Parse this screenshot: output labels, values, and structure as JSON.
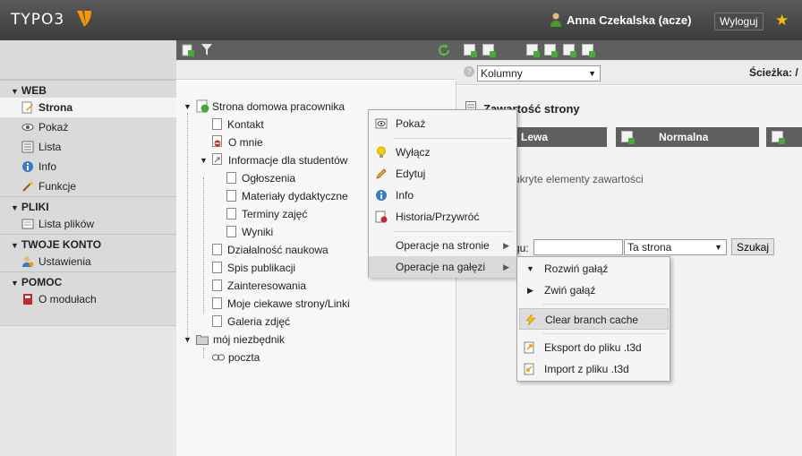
{
  "header": {
    "logo_text": "TYPO3",
    "user_name": "Anna Czekalska (acze)",
    "logout_label": "Wyloguj"
  },
  "module_menu": {
    "groups": [
      {
        "title": "WEB",
        "items": [
          {
            "label": "Strona",
            "icon": "page-edit-icon",
            "active": true
          },
          {
            "label": "Pokaż",
            "icon": "eye-icon"
          },
          {
            "label": "Lista",
            "icon": "list-icon"
          },
          {
            "label": "Info",
            "icon": "info-icon"
          },
          {
            "label": "Funkcje",
            "icon": "wand-icon"
          }
        ]
      },
      {
        "title": "PLIKI",
        "items": [
          {
            "label": "Lista plików",
            "icon": "filelist-icon"
          }
        ]
      },
      {
        "title": "TWOJE KONTO",
        "items": [
          {
            "label": "Ustawienia",
            "icon": "user-settings-icon"
          }
        ]
      },
      {
        "title": "POMOC",
        "items": [
          {
            "label": "O modułach",
            "icon": "book-icon"
          }
        ]
      }
    ]
  },
  "page_tree": {
    "root": "Strona domowa pracownika",
    "nodes": [
      "Kontakt",
      "O mnie",
      "Informacje dla studentów",
      "Ogłoszenia",
      "Materiały dydaktyczne",
      "Terminy zajęć",
      "Wyniki",
      "Działalność naukowa",
      "Spis publikacji",
      "Zainteresowania",
      "Moje ciekawe strony/Linki",
      "Galeria zdjęć",
      "mój niezbędnik",
      "poczta"
    ]
  },
  "content": {
    "view_select": "Kolumny",
    "path_label": "Ścieżka: /",
    "section_title": "Zawartość strony",
    "columns": [
      "Lewa",
      "Normalna"
    ],
    "hidden_elements_text": "ukryte elementy zawartości",
    "search_label": "gu:",
    "search_value": "",
    "scope_select": "Ta strona",
    "search_button": "Szukaj"
  },
  "context_menu": {
    "items": [
      {
        "label": "Pokaż",
        "icon": "view-icon"
      },
      {
        "label": "Wyłącz",
        "icon": "bulb-icon"
      },
      {
        "label": "Edytuj",
        "icon": "pencil-icon"
      },
      {
        "label": "Info",
        "icon": "info-icon"
      },
      {
        "label": "Historia/Przywróć",
        "icon": "history-icon"
      },
      {
        "label": "Operacje na stronie",
        "icon": ""
      },
      {
        "label": "Operacje na gałęzi",
        "icon": ""
      }
    ]
  },
  "branch_submenu": {
    "items": [
      {
        "label": "Rozwiń gałąź",
        "icon": "expand-icon"
      },
      {
        "label": "Zwiń gałąź",
        "icon": "collapse-icon"
      },
      {
        "label": "Clear branch cache",
        "icon": "lightning-icon"
      },
      {
        "label": "Eksport do pliku .t3d",
        "icon": "export-icon"
      },
      {
        "label": "Import z pliku .t3d",
        "icon": "import-icon"
      }
    ]
  },
  "colors": {
    "topbar": "#464646",
    "accent_orange": "#f49700",
    "star": "#f4c000"
  }
}
